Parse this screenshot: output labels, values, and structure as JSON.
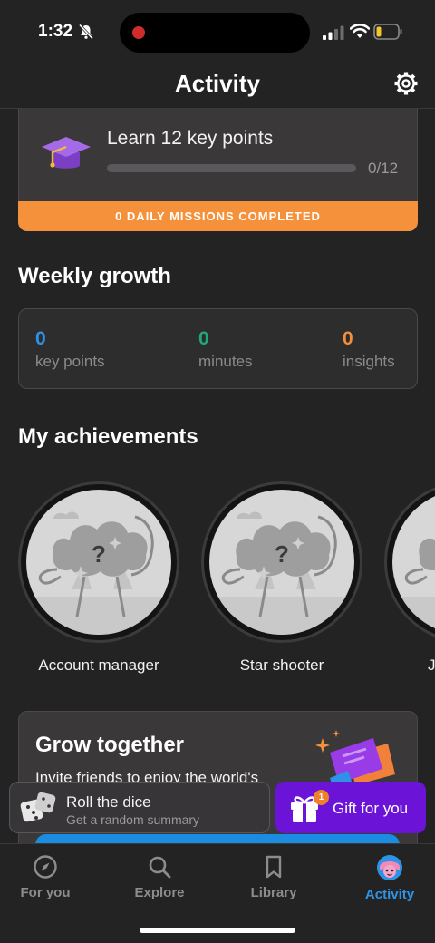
{
  "status_bar": {
    "time": "1:32"
  },
  "header": {
    "title": "Activity"
  },
  "mission": {
    "text": "Learn 12 key points",
    "progress_label": "0/12",
    "progress_fraction": 0,
    "banner": "0 DAILY MISSIONS COMPLETED"
  },
  "weekly": {
    "title": "Weekly growth",
    "stats": [
      {
        "value": "0",
        "label": "key points",
        "color": "#2e93e6"
      },
      {
        "value": "0",
        "label": "minutes",
        "color": "#22a877"
      },
      {
        "value": "0",
        "label": "insights",
        "color": "#f0903a"
      }
    ]
  },
  "achievements": {
    "title": "My achievements",
    "items": [
      {
        "label": "Account manager"
      },
      {
        "label": "Star shooter"
      },
      {
        "label": "J"
      }
    ]
  },
  "grow": {
    "title": "Grow together",
    "text": "Invite friends to enjoy the world's"
  },
  "roll": {
    "title": "Roll the dice",
    "subtitle": "Get a random summary"
  },
  "gift": {
    "label": "Gift for you",
    "badge": "1"
  },
  "tabs": [
    {
      "label": "For you",
      "icon": "compass-icon"
    },
    {
      "label": "Explore",
      "icon": "search-icon"
    },
    {
      "label": "Library",
      "icon": "bookmark-icon"
    },
    {
      "label": "Activity",
      "icon": "avatar-icon",
      "active": true
    }
  ],
  "colors": {
    "accent": "#2e93e6",
    "orange": "#f4913a",
    "purple": "#6b13d6",
    "background": "#232324"
  }
}
